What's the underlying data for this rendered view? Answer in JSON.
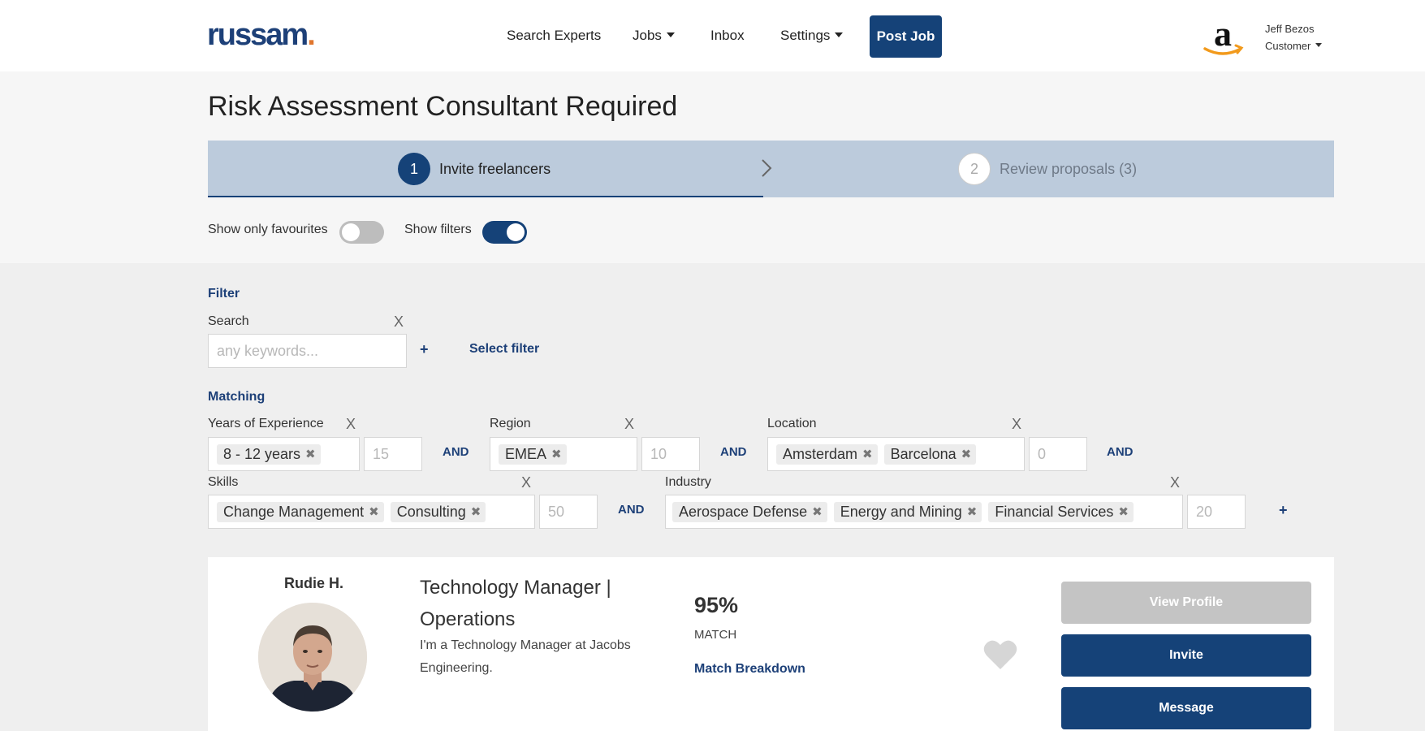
{
  "header": {
    "logo_text": "russam",
    "logo_dot": ".",
    "nav": {
      "search_experts": "Search Experts",
      "jobs": "Jobs",
      "inbox": "Inbox",
      "settings": "Settings"
    },
    "post_job": "Post Job",
    "user": {
      "name": "Jeff Bezos",
      "role": "Customer"
    },
    "colors": {
      "brand": "#154278",
      "logo_dot": "#e0762e"
    }
  },
  "page": {
    "title": "Risk Assessment Consultant Required",
    "steps": [
      {
        "number": "1",
        "label": "Invite freelancers",
        "active": true
      },
      {
        "number": "2",
        "label": "Review proposals (3)",
        "active": false
      }
    ],
    "toggles": {
      "favourites": {
        "label": "Show only favourites",
        "on": false
      },
      "filters": {
        "label": "Show filters",
        "on": true
      }
    }
  },
  "filter": {
    "heading": "Filter",
    "search": {
      "label": "Search",
      "placeholder": "any keywords...",
      "clear": "X"
    },
    "add": "+",
    "select_filter": "Select filter"
  },
  "matching": {
    "heading": "Matching",
    "and": "AND",
    "clear": "X",
    "add": "+",
    "rows": [
      {
        "fields": [
          {
            "label": "Years of Experience",
            "tags": [
              "8 - 12 years"
            ],
            "weight": "15"
          },
          {
            "label": "Region",
            "tags": [
              "EMEA"
            ],
            "weight": "10"
          },
          {
            "label": "Location",
            "tags": [
              "Amsterdam",
              "Barcelona"
            ],
            "weight": "0"
          }
        ]
      },
      {
        "fields": [
          {
            "label": "Skills",
            "tags": [
              "Change Management",
              "Consulting"
            ],
            "weight": "50"
          },
          {
            "label": "Industry",
            "tags": [
              "Aerospace Defense",
              "Energy and Mining",
              "Financial Services"
            ],
            "weight": "20"
          }
        ]
      }
    ]
  },
  "freelancer": {
    "name": "Rudie H.",
    "title": "Technology Manager | Operations",
    "description": "I'm a Technology Manager at Jacobs Engineering.",
    "match_percent": "95%",
    "match_label": "MATCH",
    "match_breakdown": "Match Breakdown",
    "buttons": {
      "view_profile": "View Profile",
      "invite": "Invite",
      "message": "Message"
    }
  }
}
